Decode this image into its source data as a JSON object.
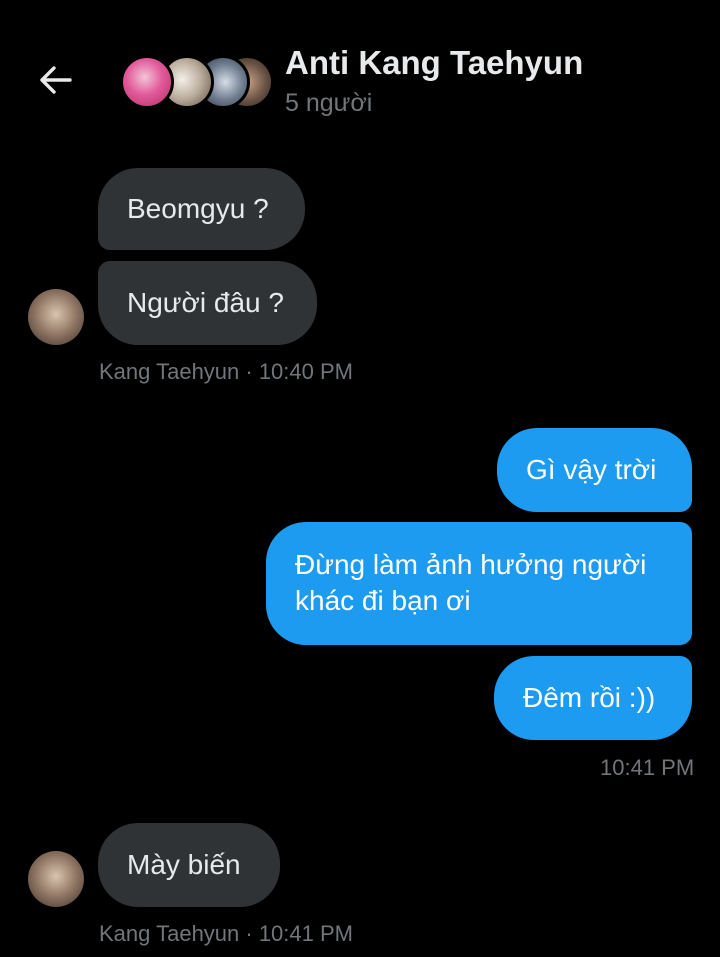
{
  "header": {
    "back_icon": "arrow-left-icon",
    "title": "Anti Kang Taehyun",
    "subtitle": "5 người",
    "avatar_icons": [
      "group-avatar-1",
      "group-avatar-2",
      "group-avatar-3",
      "group-avatar-4"
    ]
  },
  "messages": {
    "m1": {
      "text": "Beomgyu ?"
    },
    "m2": {
      "text": "Người đâu ?"
    },
    "meta1": "Kang Taehyun · 10:40 PM",
    "m3": {
      "text": "Gì vậy trời"
    },
    "m4": {
      "line1": "Đừng làm ảnh hưởng người",
      "line2": "khác đi bạn ơi"
    },
    "m5": {
      "text": "Đêm rồi :))"
    },
    "meta2": "10:41 PM",
    "m6": {
      "text": "Mày biến"
    },
    "meta3": "Kang Taehyun · 10:41 PM"
  },
  "colors": {
    "background": "#000000",
    "incoming_bubble": "#2f3336",
    "outgoing_bubble": "#1d9bf0",
    "secondary_text": "#71767b"
  }
}
